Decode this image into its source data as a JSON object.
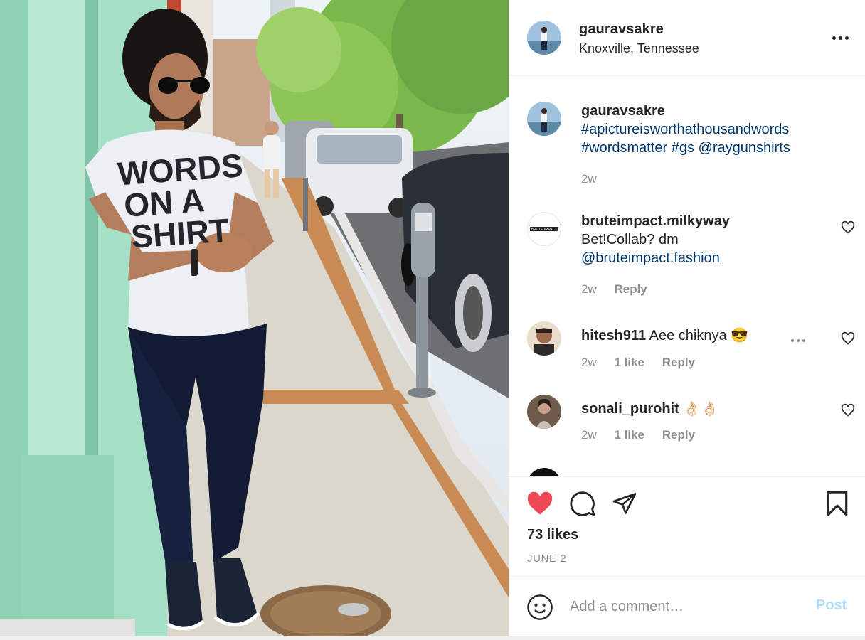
{
  "post": {
    "author": "gauravsakre",
    "location": "Knoxville, Tennessee",
    "shirt_text": [
      "WORDS",
      "ON A",
      "SHIRT"
    ]
  },
  "caption": {
    "user": "gauravsakre",
    "text_parts": [
      "#apictureisworthathousandwords",
      "#wordsmatter #gs @raygunshirts"
    ],
    "time": "2w"
  },
  "comments": [
    {
      "user": "bruteimpact.milkyway",
      "text": "Bet!Collab? dm",
      "mention": "@bruteimpact.fashion",
      "time": "2w",
      "reply": "Reply",
      "avatar_text": "BRUTE IMPACT"
    },
    {
      "user": "hitesh911",
      "text": "Aee chiknya 😎",
      "time": "2w",
      "likes": "1 like",
      "reply": "Reply"
    },
    {
      "user": "sonali_purohit",
      "text": "👌🏻👌🏻",
      "time": "2w",
      "likes": "1 like",
      "reply": "Reply"
    }
  ],
  "stats": {
    "likes": "73 likes",
    "date": "JUNE 2"
  },
  "add_comment": {
    "placeholder": "Add a comment…",
    "post_label": "Post"
  },
  "colors": {
    "heart": "#ed4956",
    "link": "#00376b",
    "muted": "#8e8e8e",
    "post_disabled": "#b2dffc"
  },
  "icons": [
    "more-icon",
    "heart-filled-icon",
    "comment-icon",
    "share-icon",
    "bookmark-icon",
    "emoji-icon",
    "heart-outline-icon",
    "ellipsis-icon"
  ]
}
